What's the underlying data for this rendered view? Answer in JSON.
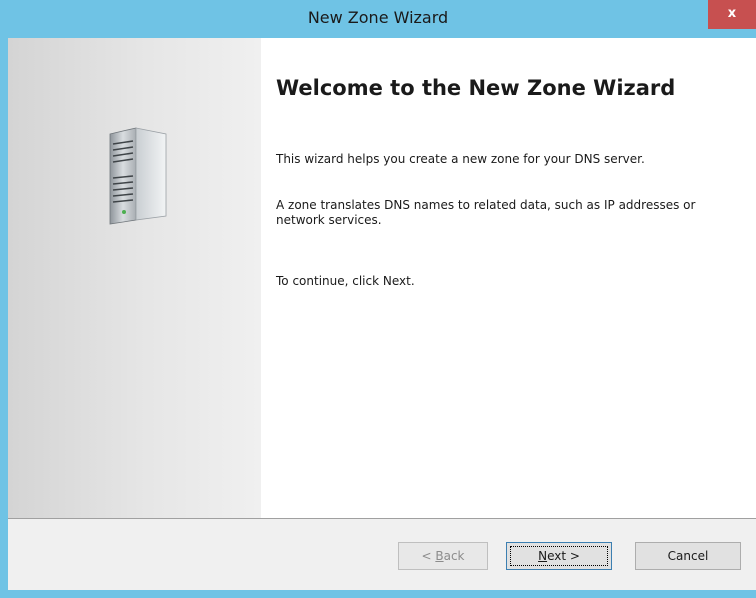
{
  "window": {
    "title": "New Zone Wizard",
    "close_label": "x"
  },
  "content": {
    "heading": "Welcome to the New Zone Wizard",
    "paragraphs": [
      "This wizard helps you create a new zone for your DNS server.",
      "A zone translates DNS names to related data, such as IP addresses or network services.",
      "To continue, click Next."
    ]
  },
  "buttons": {
    "back": {
      "pre": "< ",
      "accel": "B",
      "post": "ack",
      "enabled": false
    },
    "next": {
      "accel": "N",
      "post": "ext >",
      "default": true
    },
    "cancel": "Cancel"
  },
  "icons": {
    "illustration": "server-tower-icon"
  },
  "colors": {
    "titlebar": "#6fc3e5",
    "close": "#c75050"
  }
}
